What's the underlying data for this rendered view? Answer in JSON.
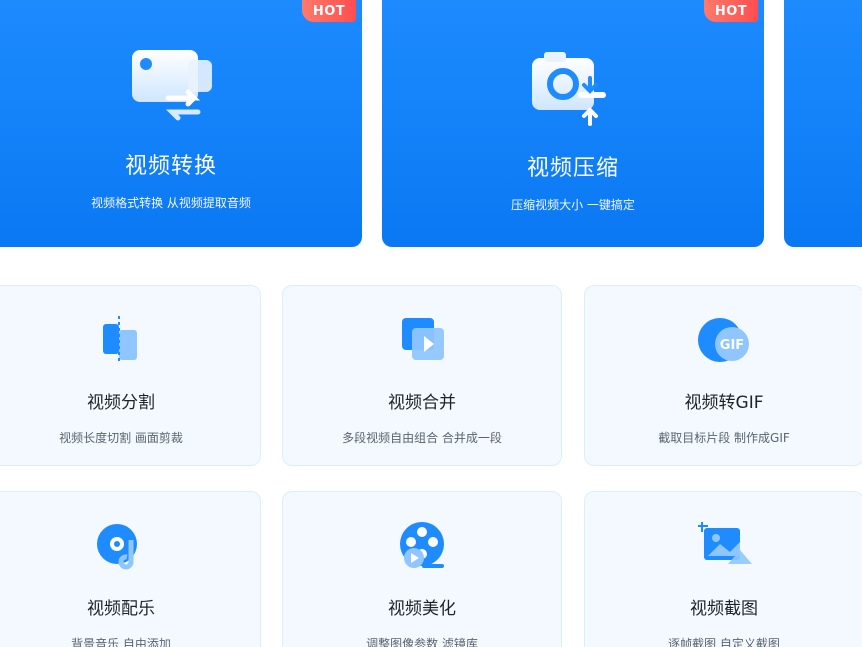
{
  "features": [
    {
      "title": "视频转换",
      "subtitle": "视频格式转换 从视频提取音频",
      "badge": "HOT",
      "icon": "video-convert-icon"
    },
    {
      "title": "视频压缩",
      "subtitle": "压缩视频大小 一键搞定",
      "badge": "HOT",
      "icon": "video-compress-icon"
    }
  ],
  "tools": [
    {
      "title": "视频分割",
      "subtitle": "视频长度切割 画面剪裁",
      "icon": "video-split-icon"
    },
    {
      "title": "视频合并",
      "subtitle": "多段视频自由组合 合并成一段",
      "icon": "video-merge-icon"
    },
    {
      "title": "视频转GIF",
      "subtitle": "截取目标片段 制作成GIF",
      "icon": "gif-icon"
    },
    {
      "title": "视频配乐",
      "subtitle": "背景音乐 自由添加",
      "icon": "music-disc-icon"
    },
    {
      "title": "视频美化",
      "subtitle": "调整图像参数 滤镜库",
      "icon": "film-reel-icon"
    },
    {
      "title": "视频截图",
      "subtitle": "逐帧截图 自定义截图",
      "icon": "screenshot-image-icon"
    }
  ],
  "colors": {
    "primary": "#0a78f2",
    "hot": "#ff4d4f",
    "card_bg": "#f3f9fe"
  }
}
